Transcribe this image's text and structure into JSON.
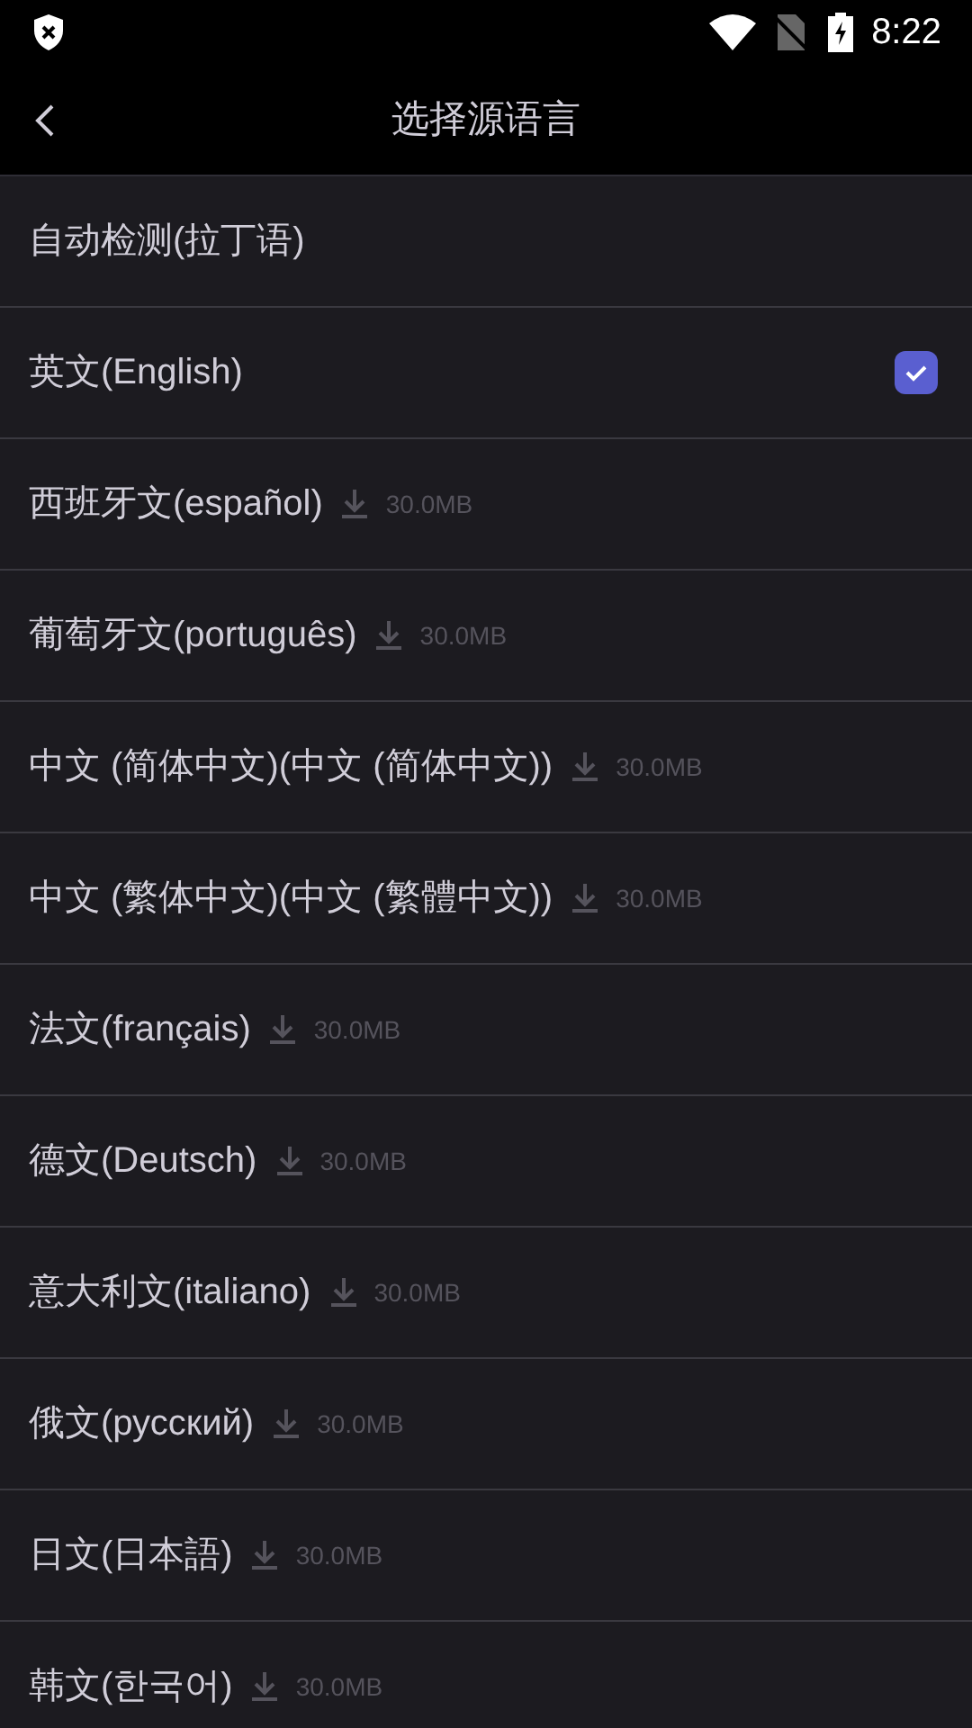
{
  "status_bar": {
    "time": "8:22"
  },
  "toolbar": {
    "title": "选择源语言"
  },
  "languages": [
    {
      "label": "自动检测(拉丁语)",
      "selected": false
    },
    {
      "label": "英文(English)",
      "selected": true
    },
    {
      "label": "西班牙文(español)",
      "selected": false,
      "size": "30.0MB"
    },
    {
      "label": "葡萄牙文(português)",
      "selected": false,
      "size": "30.0MB"
    },
    {
      "label": "中文 (简体中文)(中文 (简体中文))",
      "selected": false,
      "size": "30.0MB"
    },
    {
      "label": "中文 (繁体中文)(中文 (繁體中文))",
      "selected": false,
      "size": "30.0MB"
    },
    {
      "label": "法文(français)",
      "selected": false,
      "size": "30.0MB"
    },
    {
      "label": "德文(Deutsch)",
      "selected": false,
      "size": "30.0MB"
    },
    {
      "label": "意大利文(italiano)",
      "selected": false,
      "size": "30.0MB"
    },
    {
      "label": "俄文(русский)",
      "selected": false,
      "size": "30.0MB"
    },
    {
      "label": "日文(日本語)",
      "selected": false,
      "size": "30.0MB"
    },
    {
      "label": "韩文(한국어)",
      "selected": false,
      "size": "30.0MB"
    }
  ]
}
